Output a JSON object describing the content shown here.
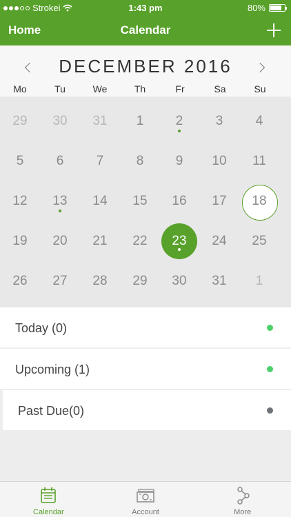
{
  "status_bar": {
    "carrier": "Strokei",
    "time": "1:43 pm",
    "battery": "80%",
    "battery_level": 0.8
  },
  "nav": {
    "home_label": "Home",
    "title": "Calendar",
    "add_icon": "plus-icon"
  },
  "calendar": {
    "month_label": "DECEMBER 2016",
    "weekdays": [
      "Mo",
      "Tu",
      "We",
      "Th",
      "Fr",
      "Sa",
      "Su"
    ],
    "weeks": [
      [
        {
          "d": "29",
          "muted": true
        },
        {
          "d": "30",
          "muted": true
        },
        {
          "d": "31",
          "muted": true
        },
        {
          "d": "1"
        },
        {
          "d": "2",
          "dot": true
        },
        {
          "d": "3"
        },
        {
          "d": "4"
        }
      ],
      [
        {
          "d": "5"
        },
        {
          "d": "6"
        },
        {
          "d": "7"
        },
        {
          "d": "8"
        },
        {
          "d": "9"
        },
        {
          "d": "10"
        },
        {
          "d": "11"
        }
      ],
      [
        {
          "d": "12"
        },
        {
          "d": "13",
          "dot": true
        },
        {
          "d": "14"
        },
        {
          "d": "15"
        },
        {
          "d": "16"
        },
        {
          "d": "17"
        },
        {
          "d": "18",
          "today": true
        }
      ],
      [
        {
          "d": "19"
        },
        {
          "d": "20"
        },
        {
          "d": "21"
        },
        {
          "d": "22"
        },
        {
          "d": "23",
          "selected": true,
          "dot": true
        },
        {
          "d": "24"
        },
        {
          "d": "25"
        }
      ],
      [
        {
          "d": "26"
        },
        {
          "d": "27"
        },
        {
          "d": "28"
        },
        {
          "d": "29"
        },
        {
          "d": "30"
        },
        {
          "d": "31"
        },
        {
          "d": "1",
          "muted": true
        }
      ]
    ],
    "accent_color": "#58a12a"
  },
  "tasks": {
    "items": [
      {
        "label": "Today (0)",
        "dot_color": "#4cd16a"
      },
      {
        "label": "Upcoming (1)",
        "dot_color": "#4cd16a"
      },
      {
        "label": "Past Due(0)",
        "dot_color": "#6e7178"
      }
    ]
  },
  "tab_bar": {
    "tabs": [
      {
        "label": "Calendar",
        "icon": "calendar-icon",
        "active": true
      },
      {
        "label": "Account",
        "icon": "money-icon",
        "active": false
      },
      {
        "label": "More",
        "icon": "share-icon",
        "active": false
      }
    ]
  }
}
